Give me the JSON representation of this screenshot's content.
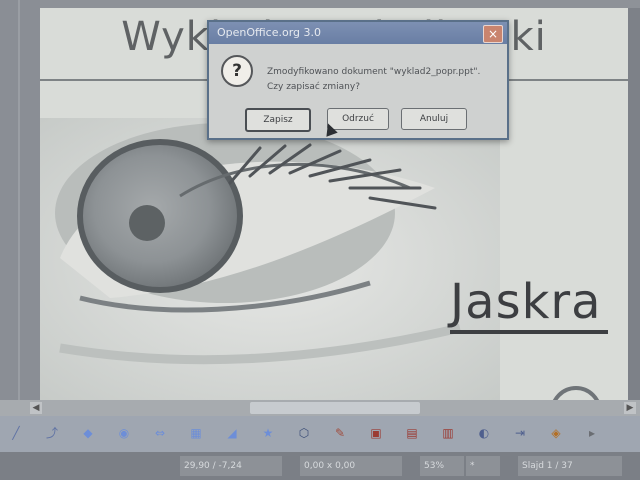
{
  "slide": {
    "title": "Wykłady z okulistyki",
    "headline": "Jaskra"
  },
  "dialog": {
    "title": "OpenOffice.org 3.0",
    "message_line1": "Zmodyfikowano dokument \"wyklad2_popr.ppt\".",
    "message_line2": "Czy zapisać zmiany?",
    "buttons": {
      "save": "Zapisz",
      "discard": "Odrzuć",
      "cancel": "Anuluj"
    },
    "close_symbol": "×"
  },
  "statusbar": {
    "position": "29,90 / -7,24",
    "size": "0,00 x 0,00",
    "zoom": "53%",
    "modified": "*",
    "slide": "Slajd 1 / 37"
  },
  "toolbar": {
    "items": [
      {
        "icon": "line-icon",
        "glyph": "╱",
        "color": "#5f72a4"
      },
      {
        "icon": "connector-icon",
        "glyph": "⤴",
        "color": "#5f72a4"
      },
      {
        "icon": "diamond-shape-icon",
        "glyph": "◆",
        "color": "#6d8ed8"
      },
      {
        "icon": "globe-shape-icon",
        "glyph": "◉",
        "color": "#6d8ed8"
      },
      {
        "icon": "arrow-shape-icon",
        "glyph": "⇔",
        "color": "#6d8ed8"
      },
      {
        "icon": "flowchart-icon",
        "glyph": "▦",
        "color": "#6d8ed8"
      },
      {
        "icon": "callout-icon",
        "glyph": "◢",
        "color": "#6d8ed8"
      },
      {
        "icon": "star-shape-icon",
        "glyph": "★",
        "color": "#6d8ed8"
      },
      {
        "icon": "points-icon",
        "glyph": "⬡",
        "color": "#3d4f78"
      },
      {
        "icon": "glue-points-icon",
        "glyph": "✎",
        "color": "#a04c3d"
      },
      {
        "icon": "fontwork-icon",
        "glyph": "▣",
        "color": "#9b3b33"
      },
      {
        "icon": "from-file-icon",
        "glyph": "▤",
        "color": "#9b3b33"
      },
      {
        "icon": "gallery-icon",
        "glyph": "▥",
        "color": "#9b3b33"
      },
      {
        "icon": "extrusion-icon",
        "glyph": "◐",
        "color": "#4f5f8e"
      },
      {
        "icon": "transition-icon",
        "glyph": "⇥",
        "color": "#4f5f8e"
      },
      {
        "icon": "custom-animation-icon",
        "glyph": "◈",
        "color": "#b46f24"
      },
      {
        "icon": "toolbar-extra-icon",
        "glyph": "▸",
        "color": "#6a6d72"
      }
    ]
  },
  "scrollbar": {
    "left_arrow": "◀",
    "right_arrow": "▶"
  }
}
